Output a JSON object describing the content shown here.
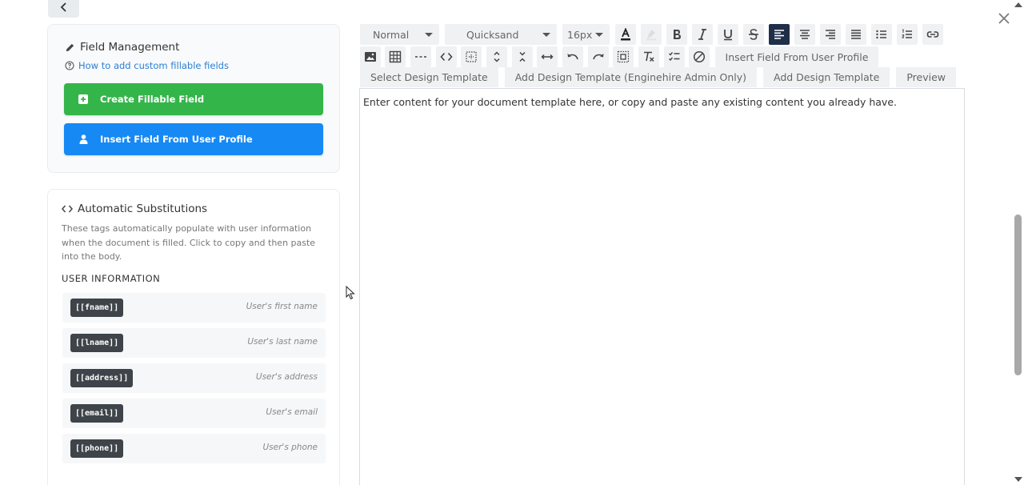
{
  "field_management": {
    "title": "Field Management",
    "title_icon": "pencil-icon",
    "help_link": "How to add custom fillable fields",
    "create_button": "Create Fillable Field",
    "insert_button": "Insert Field From User Profile",
    "colors": {
      "create": "#34b54a",
      "insert": "#1689f5",
      "link": "#2b7fd4"
    }
  },
  "auto_subs": {
    "title": "Automatic Substitutions",
    "description": "These tags automatically populate with user information when the document is filled. Click to copy and then paste into the body.",
    "section": "USER INFORMATION",
    "tags": [
      {
        "tag": "[[fname]]",
        "desc": "User's first name"
      },
      {
        "tag": "[[lname]]",
        "desc": "User's last name"
      },
      {
        "tag": "[[address]]",
        "desc": "User's address"
      },
      {
        "tag": "[[email]]",
        "desc": "User's email"
      },
      {
        "tag": "[[phone]]",
        "desc": "User's phone"
      }
    ]
  },
  "toolbar": {
    "style": "Normal",
    "font": "Quicksand",
    "size": "16px",
    "insert_field": "Insert Field From User Profile",
    "active_color": "#1f2f4a"
  },
  "tabs": [
    {
      "label": "Select Design Template"
    },
    {
      "label": "Add Design Template (Enginehire Admin Only)"
    },
    {
      "label": "Add Design Template"
    },
    {
      "label": "Preview"
    }
  ],
  "editor": {
    "content": "Enter content for your document template here, or copy and paste any existing content you already have."
  }
}
